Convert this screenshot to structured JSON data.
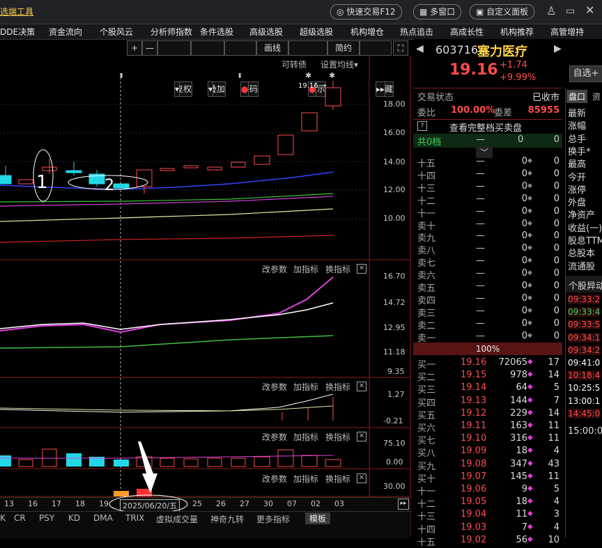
{
  "topbar": {
    "left_title": "选端工具",
    "quick_trade": "快速交易F12",
    "multi_window": "多窗口",
    "custom_panel": "自定义面板"
  },
  "menu": [
    "DDE决策",
    "资金流向",
    "个股风云",
    "分析师指数",
    "条件选股",
    "高级选股",
    "超级选股",
    "机构增仓",
    "热点追击",
    "高成长性",
    "机构推荐",
    "高管增持"
  ],
  "toolbar": {
    "plus": "+",
    "minus": "—",
    "fuquan": "复权",
    "diejia": "叠加",
    "chouma": "筹码",
    "huaxian": "画线",
    "xianshi": "显示",
    "jianyue": "简约",
    "yincang": "隐藏"
  },
  "chart_header": {
    "kezhuanzhai": "可转债",
    "shezhi_junxian": "设置均线"
  },
  "price_marker": "19.16",
  "annotations": {
    "one": "1",
    "two": "2"
  },
  "subpanel_links": {
    "gai": "改参数",
    "jia": "加指标",
    "huan": "换指标"
  },
  "axis": {
    "main": [
      "18.00",
      "16.00",
      "14.00",
      "12.00",
      "10.00"
    ],
    "p2": [
      "16.70",
      "14.72",
      "12.95",
      "11.18",
      "9.35"
    ],
    "p3": [
      "1.27",
      "-0.21"
    ],
    "p4": [
      "75.10",
      "0.00"
    ],
    "p5": [
      "30.00"
    ]
  },
  "dates": [
    "13",
    "16",
    "17",
    "18",
    "19",
    "2025/06/20/五",
    "25",
    "26",
    "27",
    "30",
    "07",
    "02",
    "03"
  ],
  "bottom_tabs": [
    "CR",
    "PSY",
    "KD",
    "DMA",
    "TRIX",
    "虚拟成交量",
    "神奇九转",
    "更多指标",
    "模板"
  ],
  "stock": {
    "code": "603716",
    "name": "塞力医疗",
    "price": "19.16",
    "change": "+1.74",
    "pct": "+9.99%",
    "zixuan": "自选+",
    "status_label": "交易状态",
    "status": "已收市",
    "weibi_label": "委比",
    "weibi": "100.00%",
    "weicha_label": "委差",
    "weicha": "85955",
    "full_book": "查看完整档买卖盘",
    "gong": "共0档",
    "ratio": "100%"
  },
  "sell_levels": [
    {
      "label": "十五",
      "price": "—",
      "vol": "0",
      "cnt": "0"
    },
    {
      "label": "十四",
      "price": "—",
      "vol": "0",
      "cnt": "0"
    },
    {
      "label": "十三",
      "price": "—",
      "vol": "0",
      "cnt": "0"
    },
    {
      "label": "十二",
      "price": "—",
      "vol": "0",
      "cnt": "0"
    },
    {
      "label": "十一",
      "price": "—",
      "vol": "0",
      "cnt": "0"
    },
    {
      "label": "卖十",
      "price": "—",
      "vol": "0",
      "cnt": "0"
    },
    {
      "label": "卖九",
      "price": "—",
      "vol": "0",
      "cnt": "0"
    },
    {
      "label": "卖八",
      "price": "—",
      "vol": "0",
      "cnt": "0"
    },
    {
      "label": "卖七",
      "price": "—",
      "vol": "0",
      "cnt": "0"
    },
    {
      "label": "卖六",
      "price": "—",
      "vol": "0",
      "cnt": "0"
    },
    {
      "label": "卖五",
      "price": "—",
      "vol": "0",
      "cnt": "0"
    },
    {
      "label": "卖四",
      "price": "—",
      "vol": "0",
      "cnt": "0"
    },
    {
      "label": "卖三",
      "price": "—",
      "vol": "0",
      "cnt": "0"
    },
    {
      "label": "卖二",
      "price": "—",
      "vol": "0",
      "cnt": "0"
    },
    {
      "label": "卖一",
      "price": "—",
      "vol": "0",
      "cnt": "0"
    }
  ],
  "buy_levels": [
    {
      "label": "买一",
      "price": "19.16",
      "vol": "72065",
      "cnt": "17"
    },
    {
      "label": "买二",
      "price": "19.15",
      "vol": "978",
      "cnt": "14"
    },
    {
      "label": "买三",
      "price": "19.14",
      "vol": "64",
      "cnt": "5"
    },
    {
      "label": "买四",
      "price": "19.13",
      "vol": "144",
      "cnt": "7"
    },
    {
      "label": "买五",
      "price": "19.12",
      "vol": "229",
      "cnt": "14"
    },
    {
      "label": "买六",
      "price": "19.11",
      "vol": "163",
      "cnt": "11"
    },
    {
      "label": "买七",
      "price": "19.10",
      "vol": "316",
      "cnt": "11"
    },
    {
      "label": "买八",
      "price": "19.09",
      "vol": "18",
      "cnt": "4"
    },
    {
      "label": "买九",
      "price": "19.08",
      "vol": "347",
      "cnt": "43"
    },
    {
      "label": "买十",
      "price": "19.07",
      "vol": "145",
      "cnt": "11"
    },
    {
      "label": "十一",
      "price": "19.06",
      "vol": "9",
      "cnt": "5"
    },
    {
      "label": "十二",
      "price": "19.05",
      "vol": "18",
      "cnt": "4"
    },
    {
      "label": "十三",
      "price": "19.04",
      "vol": "11",
      "cnt": "3"
    },
    {
      "label": "十四",
      "price": "19.03",
      "vol": "7",
      "cnt": "4"
    },
    {
      "label": "十五",
      "price": "19.02",
      "vol": "56",
      "cnt": "10"
    }
  ],
  "right_tabs": {
    "pankou": "盘口",
    "zi": "资"
  },
  "right_labels": [
    "最新",
    "涨幅",
    "总手",
    "换手*",
    "最高",
    "今开",
    "涨停",
    "外盘",
    "净资产",
    "收益(一)",
    "股息TTM",
    "总股本",
    "流通股"
  ],
  "yidong_title": "个股异动",
  "times": [
    "09:33:2",
    "09:33:4",
    "09:33:5",
    "09:34:1",
    "09:34:2",
    "09:41:0",
    "10:18:4",
    "10:25:5",
    "13:00:1",
    "14:45:0"
  ],
  "time_colors": [
    "#ff4c4c",
    "#3bd35a",
    "#ff4c4c",
    "#ff4c4c",
    "#ff4c4c",
    "#ffffff",
    "#ff4c4c",
    "#ffffff",
    "#ffffff",
    "#ff4c4c"
  ],
  "bottom_time": "15:00:0"
}
